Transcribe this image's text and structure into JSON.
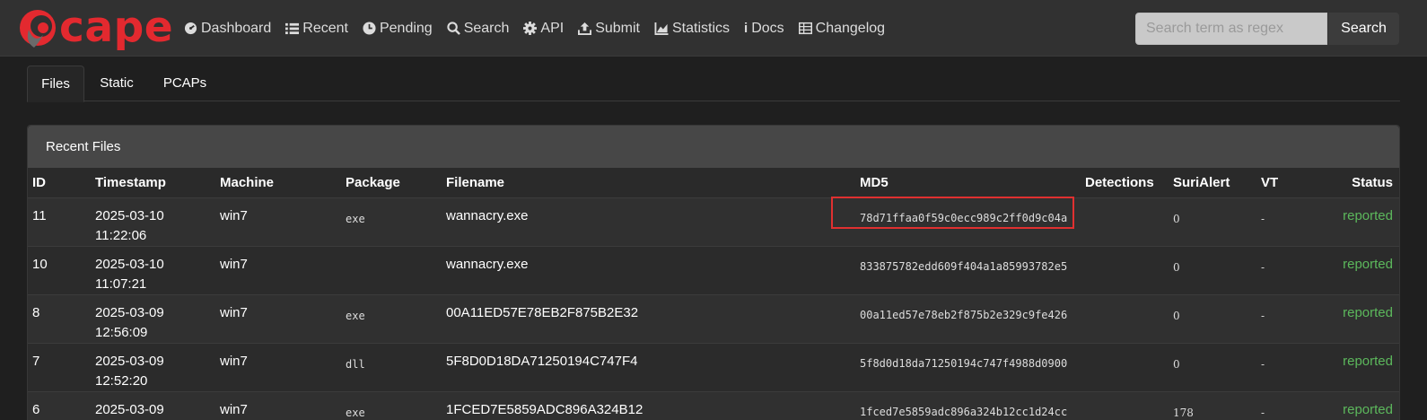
{
  "brand": {
    "name": "cape"
  },
  "nav": [
    {
      "label": "Dashboard",
      "icon": "dashboard-icon"
    },
    {
      "label": "Recent",
      "icon": "list-icon"
    },
    {
      "label": "Pending",
      "icon": "clock-icon"
    },
    {
      "label": "Search",
      "icon": "search-icon"
    },
    {
      "label": "API",
      "icon": "gear-icon"
    },
    {
      "label": "Submit",
      "icon": "upload-icon"
    },
    {
      "label": "Statistics",
      "icon": "chart-icon"
    },
    {
      "label": "Docs",
      "icon": "info-icon"
    },
    {
      "label": "Changelog",
      "icon": "table-icon"
    }
  ],
  "search": {
    "placeholder": "Search term as regex",
    "button_label": "Search"
  },
  "tabs": [
    {
      "label": "Files",
      "active": true
    },
    {
      "label": "Static",
      "active": false
    },
    {
      "label": "PCAPs",
      "active": false
    }
  ],
  "panel": {
    "title": "Recent Files"
  },
  "table": {
    "columns": [
      "ID",
      "Timestamp",
      "Machine",
      "Package",
      "Filename",
      "MD5",
      "Detections",
      "SuriAlert",
      "VT",
      "Status"
    ],
    "rows": [
      {
        "id": "11",
        "date": "2025-03-10",
        "time": "11:22:06",
        "machine": "win7",
        "package": "exe",
        "filename": "wannacry.exe",
        "md5": "78d71ffaa0f59c0ecc989c2ff0d9c04a",
        "detections": "",
        "surialert": "0",
        "vt": "-",
        "status": "reported"
      },
      {
        "id": "10",
        "date": "2025-03-10",
        "time": "11:07:21",
        "machine": "win7",
        "package": "",
        "filename": "wannacry.exe",
        "md5": "833875782edd609f404a1a85993782e5",
        "detections": "",
        "surialert": "0",
        "vt": "-",
        "status": "reported"
      },
      {
        "id": "8",
        "date": "2025-03-09",
        "time": "12:56:09",
        "machine": "win7",
        "package": "exe",
        "filename": "00A11ED57E78EB2F875B2E32",
        "md5": "00a11ed57e78eb2f875b2e329c9fe426",
        "detections": "",
        "surialert": "0",
        "vt": "-",
        "status": "reported"
      },
      {
        "id": "7",
        "date": "2025-03-09",
        "time": "12:52:20",
        "machine": "win7",
        "package": "dll",
        "filename": "5F8D0D18DA71250194C747F4",
        "md5": "5f8d0d18da71250194c747f4988d0900",
        "detections": "",
        "surialert": "0",
        "vt": "-",
        "status": "reported"
      },
      {
        "id": "6",
        "date": "2025-03-09",
        "time": "",
        "machine": "win7",
        "package": "exe",
        "filename": "1FCED7E5859ADC896A324B12",
        "md5": "1fced7e5859adc896a324b12cc1d24cc",
        "detections": "",
        "surialert": "178",
        "vt": "-",
        "status": "reported"
      }
    ]
  },
  "colors": {
    "brand": "#e3292f",
    "status_ok": "#5cb85c",
    "highlight": "#e03030"
  }
}
